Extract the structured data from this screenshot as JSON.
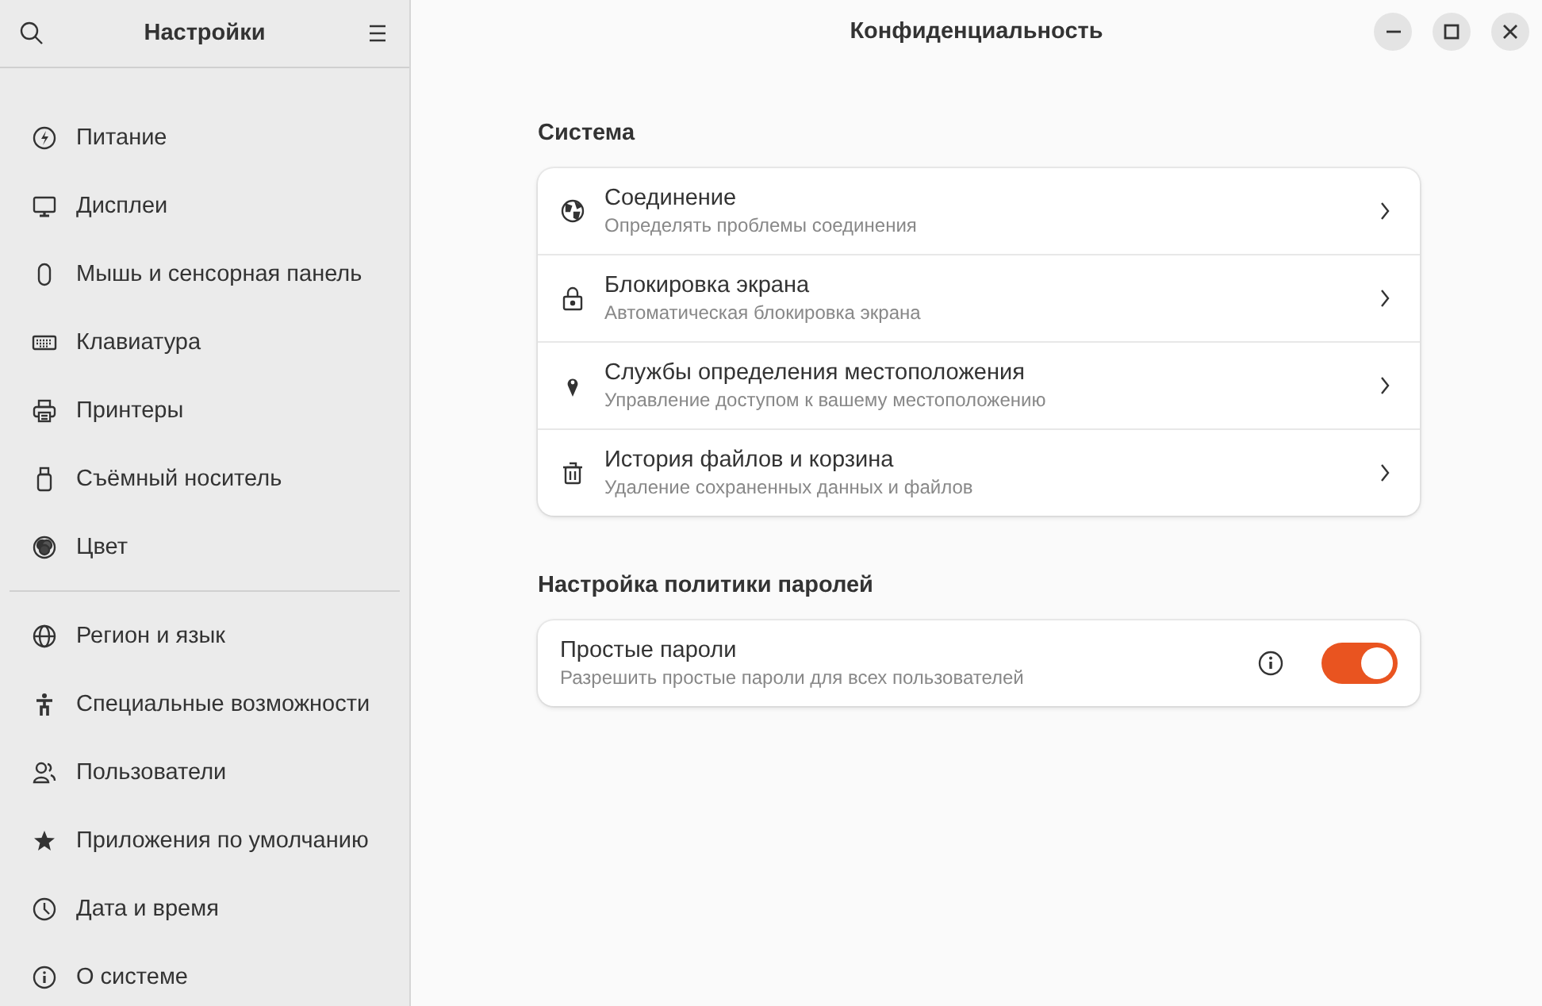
{
  "sidebar": {
    "title": "Настройки",
    "groups": [
      [
        {
          "label": "Питание",
          "selected": false
        },
        {
          "label": "Дисплеи",
          "selected": false
        },
        {
          "label": "Мышь и сенсорная панель",
          "selected": false
        },
        {
          "label": "Клавиатура",
          "selected": false
        },
        {
          "label": "Принтеры",
          "selected": false
        },
        {
          "label": "Съёмный носитель",
          "selected": false
        },
        {
          "label": "Цвет",
          "selected": false
        }
      ],
      [
        {
          "label": "Регион и язык",
          "selected": false
        },
        {
          "label": "Специальные возможности",
          "selected": false
        },
        {
          "label": "Пользователи",
          "selected": false
        },
        {
          "label": "Приложения по умолчанию",
          "selected": false
        },
        {
          "label": "Дата и время",
          "selected": false
        },
        {
          "label": "О системе",
          "selected": false
        }
      ]
    ]
  },
  "window": {
    "title": "Конфиденциальность"
  },
  "sections": [
    {
      "heading": "Система",
      "rows": [
        {
          "kind": "link",
          "title": "Соединение",
          "subtitle": "Определять проблемы соединения"
        },
        {
          "kind": "link",
          "title": "Блокировка экрана",
          "subtitle": "Автоматическая блокировка экрана"
        },
        {
          "kind": "link",
          "title": "Службы определения местоположения",
          "subtitle": "Управление доступом к вашему местоположению"
        },
        {
          "kind": "link",
          "title": "История файлов и корзина",
          "subtitle": "Удаление сохраненных данных и файлов"
        }
      ]
    },
    {
      "heading": "Настройка политики паролей",
      "rows": [
        {
          "kind": "switch",
          "title": "Простые пароли",
          "subtitle": "Разрешить простые пароли для всех пользователей",
          "on": true
        }
      ]
    }
  ]
}
